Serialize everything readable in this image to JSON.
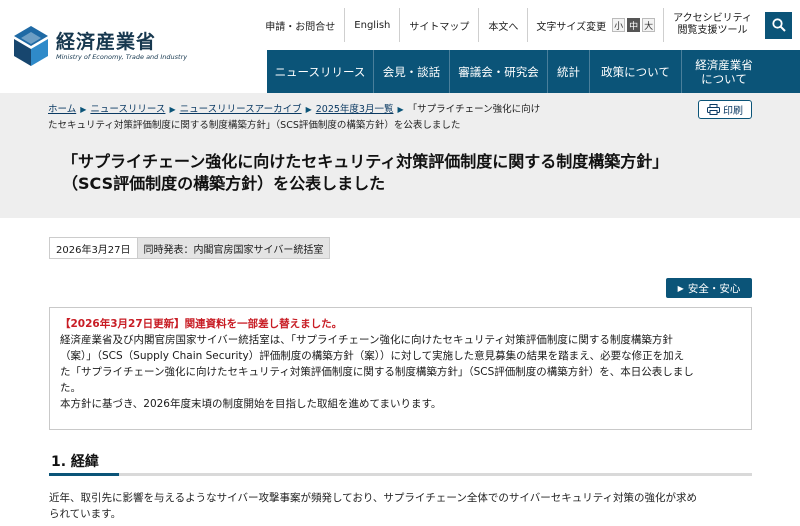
{
  "header": {
    "logo": {
      "name": "経済産業省",
      "sub": "Ministry of Economy, Trade and Industry"
    },
    "util": {
      "apply": "申請・お問合せ",
      "english": "English",
      "sitemap": "サイトマップ",
      "skip": "本文へ",
      "fontsize_label": "文字サイズ変更",
      "fs_small": "小",
      "fs_medium": "中",
      "fs_large": "大",
      "a11y_line1": "アクセシビリティ",
      "a11y_line2": "閲覧支援ツール"
    },
    "gnav": [
      {
        "label": "ニュースリリース"
      },
      {
        "label": "会見・談話"
      },
      {
        "label": "審議会・研究会"
      },
      {
        "label": "統計"
      },
      {
        "label": "政策について"
      },
      {
        "label_line1": "経済産業省",
        "label_line2": "について"
      }
    ]
  },
  "breadcrumb": {
    "home": "ホーム",
    "news": "ニュースリリース",
    "archive": "ニュースリリースアーカイブ",
    "month": "2025年度3月一覧",
    "current_line1": "「サプライチェーン強化に向け",
    "current_line2": "たセキュリティ対策評価制度に関する制度構築方針」（SCS評価制度の構築方針）を公表しました"
  },
  "print_label": "印刷",
  "title_line1": "「サプライチェーン強化に向けたセキュリティ対策評価制度に関する制度構築方針」",
  "title_line2": "（SCS評価制度の構築方針）を公表しました",
  "meta": {
    "date": "2026年3月27日",
    "simultaneous": "同時発表：内閣官房国家サイバー統括室"
  },
  "tag": "安全・安心",
  "notice": {
    "update": "【2026年3月27日更新】関連資料を一部差し替えました。",
    "line1": "経済産業省及び内閣官房国家サイバー統括室は、「サプライチェーン強化に向けたセキュリティ対策評価制度に関する制度構築方針",
    "line2": "（案）」（SCS（Supply Chain Security）評価制度の構築方針（案））に対して実施した意見募集の結果を踏まえ、必要な修正を加え",
    "line3": "た「サプライチェーン強化に向けたセキュリティ対策評価制度に関する制度構築方針」（SCS評価制度の構築方針）を、本日公表しまし",
    "line4": "た。",
    "line5": "本方針に基づき、2026年度末頃の制度開始を目指した取組を進めてまいります。"
  },
  "section": {
    "heading": "1. 経緯"
  },
  "body": {
    "line1": "近年、取引先に影響を与えるようなサイバー攻撃事案が頻発しており、サプライチェーン全体でのサイバーセキュリティ対策の強化が求め",
    "line2": "られています。"
  }
}
